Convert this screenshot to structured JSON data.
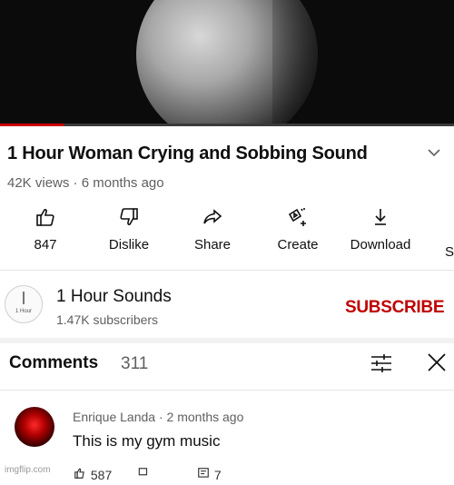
{
  "video": {
    "title": "1 Hour Woman Crying and Sobbing Sound",
    "views": "42K views",
    "separator": "·",
    "age": "6 months ago",
    "progress_fraction": 0.14,
    "progress_color": "#cc0000"
  },
  "actions": [
    {
      "label": "847",
      "icon": "thumbs-up-icon"
    },
    {
      "label": "Dislike",
      "icon": "thumbs-down-icon"
    },
    {
      "label": "Share",
      "icon": "share-icon"
    },
    {
      "label": "Create",
      "icon": "create-icon"
    },
    {
      "label": "Download",
      "icon": "download-icon"
    },
    {
      "label": "S",
      "icon": "more-action-icon"
    }
  ],
  "channel": {
    "name": "1 Hour Sounds",
    "subscribers": "1.47K subscribers",
    "avatar_text": "1 Hour",
    "subscribe_label": "SUBSCRIBE",
    "subscribe_color": "#c00000"
  },
  "comments": {
    "title": "Comments",
    "count": "311",
    "items": [
      {
        "author": "Enrique Landa",
        "separator": "·",
        "age": "2 months ago",
        "text": "This is my gym music",
        "likes": "587",
        "replies": "7"
      }
    ]
  },
  "watermark": "imgflip.com"
}
